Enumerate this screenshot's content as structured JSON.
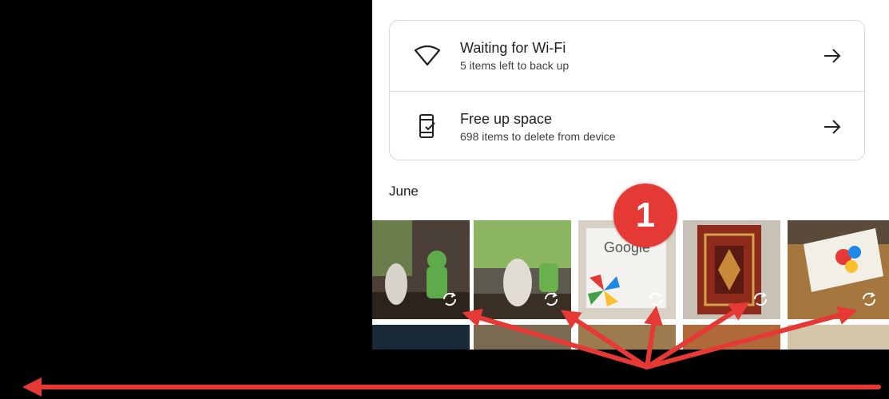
{
  "backup_card": {
    "wifi": {
      "title": "Waiting for Wi-Fi",
      "subtitle": "5 items left to back up",
      "icon": "wifi-icon"
    },
    "free_space": {
      "title": "Free up space",
      "subtitle": "698 items to delete from device",
      "icon": "phone-check-icon"
    }
  },
  "section": {
    "label": "June"
  },
  "photos": [
    {
      "name": "photo-android-figurine-1"
    },
    {
      "name": "photo-android-figurine-2"
    },
    {
      "name": "photo-google-pinwheel"
    },
    {
      "name": "photo-carpet"
    },
    {
      "name": "photo-book-cover"
    }
  ],
  "annotation": {
    "badge_number": "1",
    "color": "#e53935"
  },
  "thumb_text": {
    "google": "Google"
  }
}
